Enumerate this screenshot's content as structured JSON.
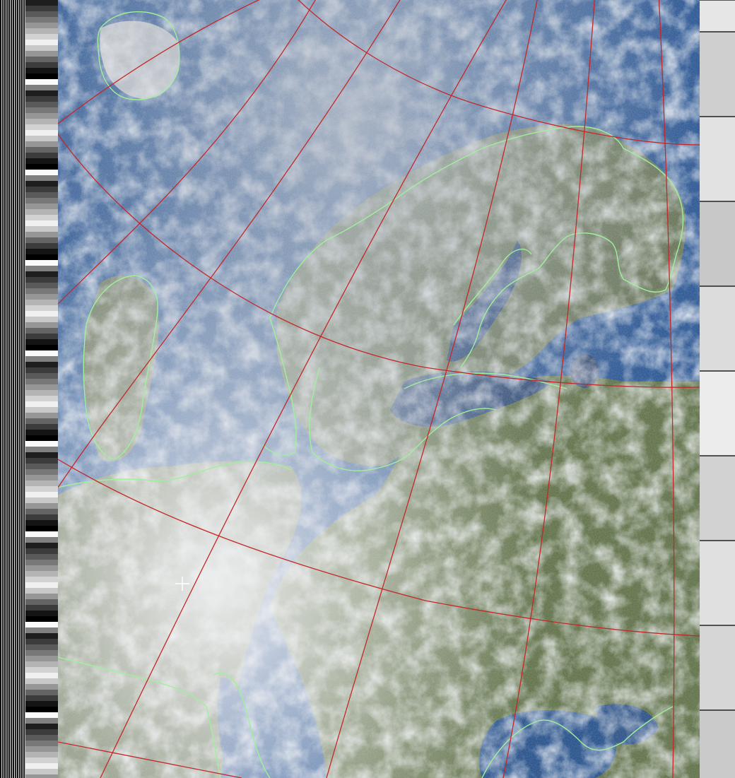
{
  "image": {
    "kind": "NOAA APT satellite weather image (false-color composite with map overlay)",
    "colors": {
      "ocean": "#1d4a86",
      "land": "#56683f",
      "cloud": "#d8dde3",
      "coastline": "#9ef09a",
      "graticule": "#c42828"
    }
  }
}
